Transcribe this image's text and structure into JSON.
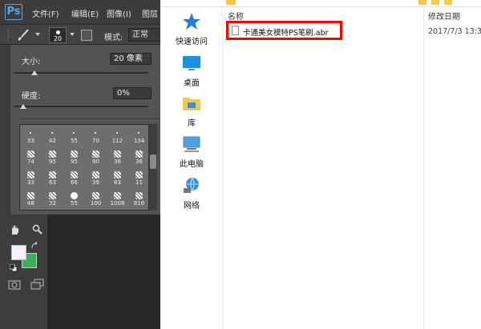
{
  "photoshop": {
    "logo": "Ps",
    "menu": [
      "文件(F)",
      "编辑(E)",
      "图像(I)",
      "图层"
    ],
    "options_bar": {
      "brush_size_preview": "20",
      "mode_label": "模式:",
      "mode_value": "正常"
    },
    "brush_panel": {
      "size_label": "大小:",
      "size_value": "20 像素",
      "hardness_label": "硬度:",
      "hardness_value": "0%",
      "presets": [
        "33",
        "42",
        "55",
        "70",
        "112",
        "134",
        "74",
        "95",
        "95",
        "90",
        "36",
        "36",
        "33",
        "63",
        "66",
        "39",
        "63",
        "11",
        "48",
        "32",
        "55",
        "100",
        "1008",
        "816"
      ]
    },
    "colors": {
      "foreground": "#eef4ff",
      "background": "#3fae5c"
    }
  },
  "explorer": {
    "nav": [
      {
        "label": "快速访问",
        "icon": "star-icon"
      },
      {
        "label": "桌面",
        "icon": "desktop-icon"
      },
      {
        "label": "库",
        "icon": "library-folder-icon"
      },
      {
        "label": "此电脑",
        "icon": "computer-icon"
      },
      {
        "label": "网络",
        "icon": "network-icon"
      }
    ],
    "columns": {
      "name": "名称",
      "date": "修改日期"
    },
    "file": {
      "name": "卡通美女模特PS笔刷.abr",
      "date": "2017/7/3 13:3"
    }
  }
}
